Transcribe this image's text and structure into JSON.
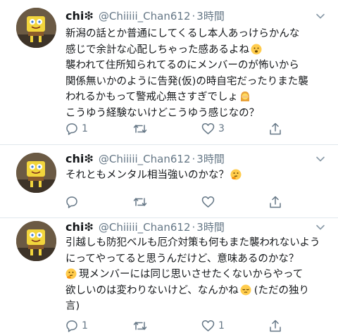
{
  "tweets": [
    {
      "author": {
        "name": "chi❇︎",
        "handle": "@Chiiiii_Chan612",
        "separator": "·",
        "time": "3時間"
      },
      "lines": [
        "新潟の話とか普通にしてくるし本人あっけらかんな",
        "感じで余計な心配しちゃった感あるよね",
        "襲われて住所知られてるのにメンバーのが怖いから",
        "関係無いかのように告発(仮)の時自宅だったりまた襲",
        "われるかもって警戒心無さすぎでしょ",
        "こうゆう経験ないけどこうゆう感じなの？"
      ],
      "emojis": [
        "worried-face",
        "facepalm-woman"
      ],
      "actions": {
        "reply_count": "1",
        "retweet_count": "",
        "like_count": "3"
      }
    },
    {
      "author": {
        "name": "chi❇︎",
        "handle": "@Chiiiii_Chan612",
        "separator": "·",
        "time": "3時間"
      },
      "lines": [
        "それともメンタル相当強いのかな？"
      ],
      "emojis": [
        "thinking-face"
      ],
      "actions": {
        "reply_count": "",
        "retweet_count": "",
        "like_count": ""
      }
    },
    {
      "author": {
        "name": "chi❇︎",
        "handle": "@Chiiiii_Chan612",
        "separator": "·",
        "time": "3時間"
      },
      "lines": [
        "引越しも防犯ベルも厄介対策も何もまた襲われないよう",
        "にってやってると思うんだけど、意味あるのかな？",
        "現メンバーには同じ思いさせたくないからやって",
        "欲しいのは変わりないけど、なんかね",
        "(ただの独り",
        "言)"
      ],
      "emojis": [
        "thinking-face",
        "pensive-face"
      ],
      "actions": {
        "reply_count": "1",
        "retweet_count": "",
        "like_count": "1"
      }
    }
  ],
  "colors": {
    "text": "#14171a",
    "secondary": "#657786",
    "divider": "#e1e8ed"
  }
}
